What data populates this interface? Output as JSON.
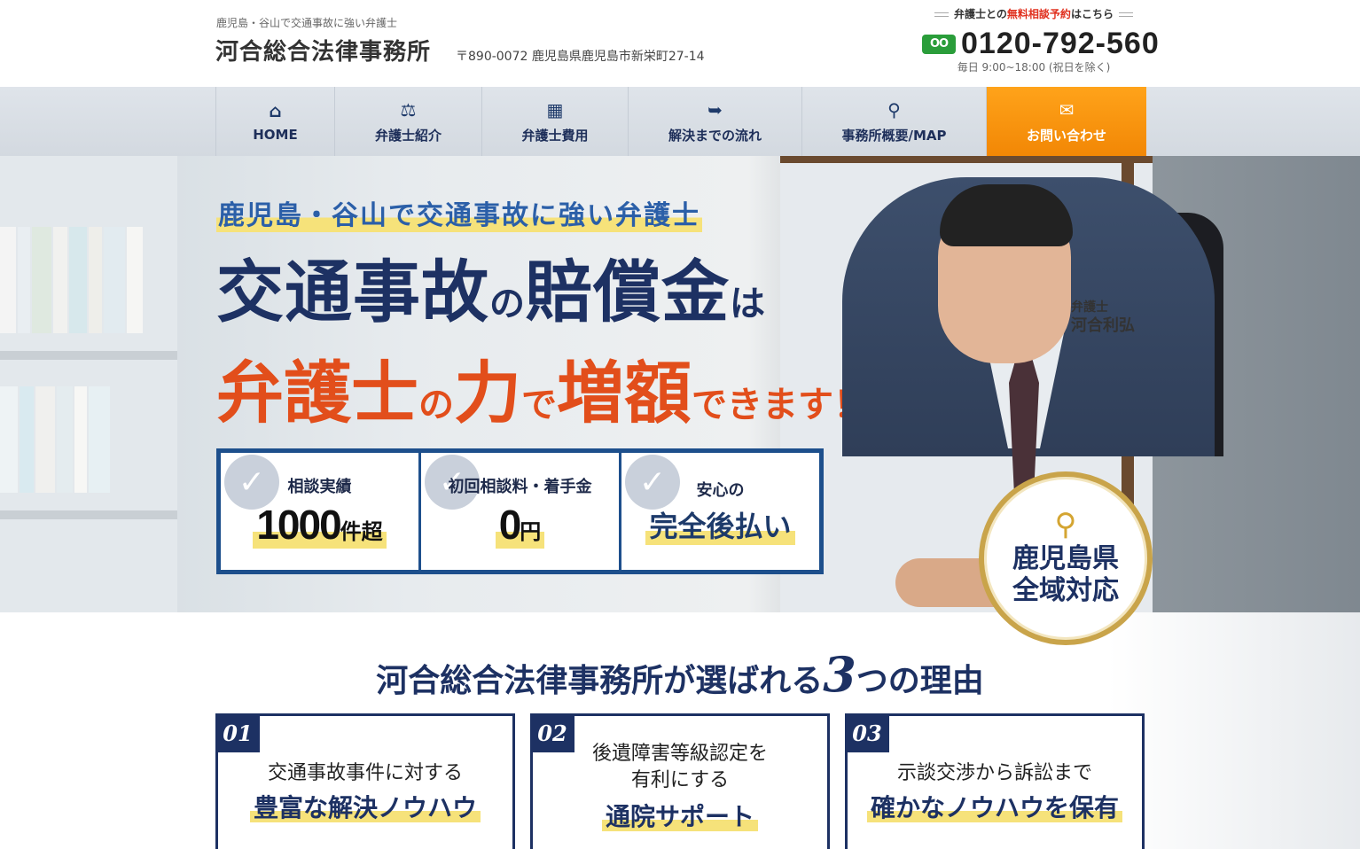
{
  "header": {
    "tagline": "鹿児島・谷山で交通事故に強い弁護士",
    "firm_name": "河合総合法律事務所",
    "address": "〒890-0072 鹿児島県鹿児島市新栄町27-14",
    "contact_lead_pre": "弁護士との",
    "contact_lead_hl": "無料相談予約",
    "contact_lead_post": "はこちら",
    "freedial_icon": "OO",
    "phone": "0120-792-560",
    "hours": "毎日 9:00~18:00 (祝日を除く)"
  },
  "nav": {
    "items": [
      {
        "label": "HOME",
        "icon": "home-icon",
        "glyph": "⌂"
      },
      {
        "label": "弁護士紹介",
        "icon": "gavel-icon",
        "glyph": "⚖"
      },
      {
        "label": "弁護士費用",
        "icon": "calculator-icon",
        "glyph": "▦"
      },
      {
        "label": "解決までの流れ",
        "icon": "arrow-icon",
        "glyph": "➥"
      },
      {
        "label": "事務所概要/MAP",
        "icon": "map-pin-icon",
        "glyph": "⚲"
      },
      {
        "label": "お問い合わせ",
        "icon": "mail-icon",
        "glyph": "✉"
      }
    ]
  },
  "hero": {
    "sub": "鹿児島・谷山で交通事故に強い弁護士",
    "line1_a": "交通事故",
    "line1_b": "の",
    "line1_c": "賠償金",
    "line1_d": "は",
    "line2_a": "弁護士",
    "line2_b": "の",
    "line2_c": "力",
    "line2_d": "で",
    "line2_e": "増額",
    "line2_f": "できます！",
    "lawyer_title": "弁護士",
    "lawyer_name": "河合利弘",
    "features": [
      {
        "label": "相談実績",
        "num": "1000",
        "unit": "件超"
      },
      {
        "label": "初回相談料・着手金",
        "num": "0",
        "unit": "円"
      },
      {
        "label": "安心の",
        "text": "完全後払い"
      }
    ],
    "badge_line1": "鹿児島県",
    "badge_line2": "全域対応"
  },
  "reasons": {
    "title_pre": "河合総合法律事務所が選ばれる",
    "title_num": "3",
    "title_post": "つの理由",
    "cards": [
      {
        "num": "01",
        "text": "交通事故事件に対する",
        "em": "豊富な解決ノウハウ"
      },
      {
        "num": "02",
        "text1": "後遺障害等級認定を",
        "text2": "有利にする",
        "em": "通院サポート"
      },
      {
        "num": "03",
        "text": "示談交渉から訴訟まで",
        "em": "確かなノウハウを保有"
      }
    ]
  },
  "colors": {
    "navy": "#1d3163",
    "accent_orange": "#f28705",
    "headline_red": "#e24e1b",
    "highlight_yellow": "#f6e27a",
    "freedial_green": "#2a9d3a"
  }
}
